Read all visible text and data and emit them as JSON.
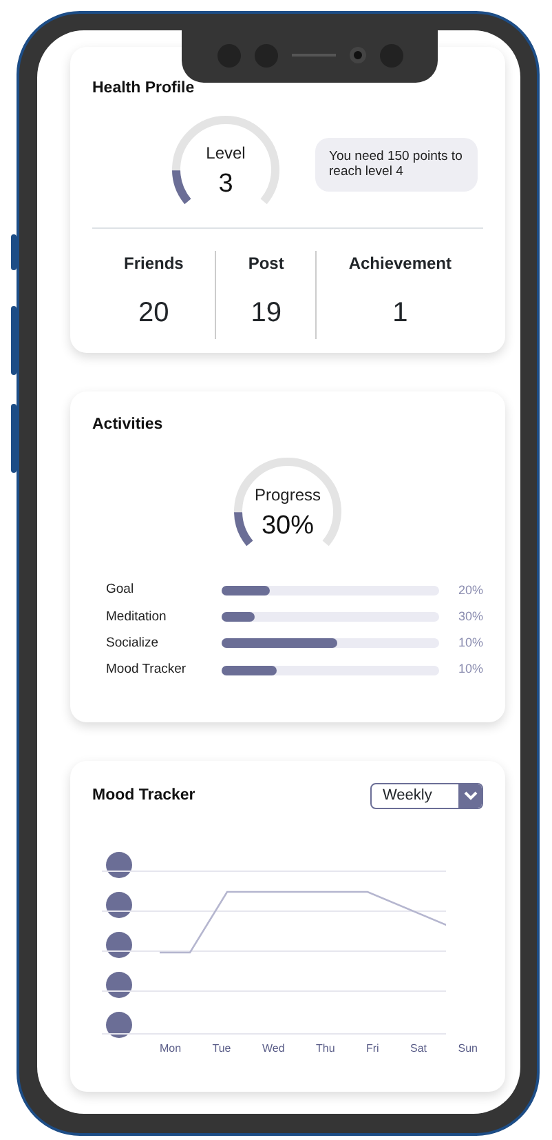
{
  "health_profile": {
    "title": "Health Profile",
    "gauge": {
      "label": "Level",
      "value": "3",
      "level": 0.15
    },
    "hint": "You need 150 points to reach level 4",
    "stats": [
      {
        "label": "Friends",
        "value": "20"
      },
      {
        "label": "Post",
        "value": "19"
      },
      {
        "label": "Achievement",
        "value": "1"
      }
    ]
  },
  "activities": {
    "title": "Activities",
    "gauge": {
      "label": "Progress",
      "value": "30%",
      "level": 0.15
    },
    "items": [
      {
        "label": "Goal",
        "level": 0.22,
        "reading": "20%"
      },
      {
        "label": "Meditation",
        "level": 0.15,
        "reading": "30%"
      },
      {
        "label": "Socialize",
        "level": 0.53,
        "reading": "10%"
      },
      {
        "label": "Mood Tracker",
        "level": 0.25,
        "reading": "10%"
      }
    ]
  },
  "mood_tracker": {
    "title": "Mood Tracker",
    "period": "Weekly",
    "days": [
      "Mon",
      "Tue",
      "Wed",
      "Thu",
      "Fri",
      "Sat",
      "Sun"
    ]
  }
}
